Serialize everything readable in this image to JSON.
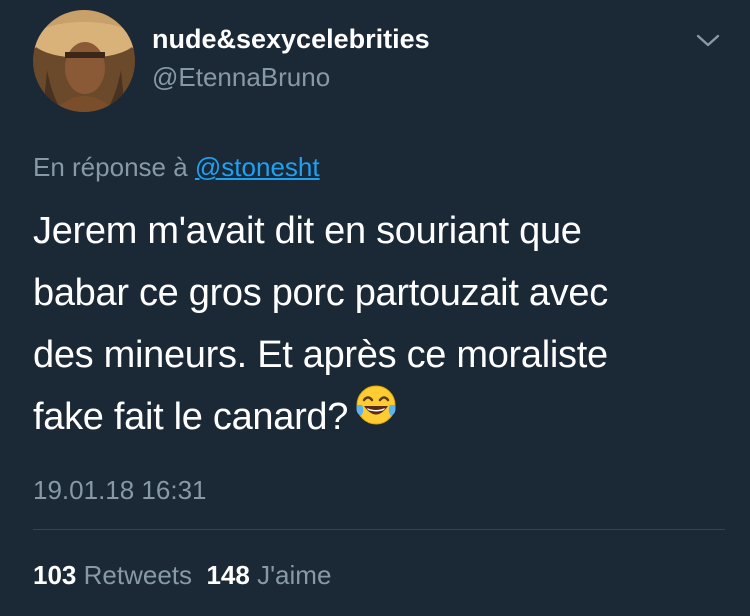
{
  "user": {
    "display_name": "nude&sexycelebrities",
    "handle": "@EtennaBruno"
  },
  "reply": {
    "prefix": "En réponse à",
    "mention": "@stonesht"
  },
  "tweet": {
    "lines": [
      "Jerem m'avait dit en souriant que",
      "babar ce gros porc partouzait avec",
      "des mineurs. Et après ce moraliste",
      "fake fait le canard?"
    ],
    "emoji": "face-with-tears-of-joy-icon",
    "timestamp": "19.01.18 16:31"
  },
  "stats": {
    "retweets_count": "103",
    "retweets_label": "Retweets",
    "likes_count": "148",
    "likes_label": "J'aime"
  },
  "colors": {
    "background": "#1b2836",
    "secondary_text": "#8899a6",
    "link": "#1da1f2",
    "divider": "#38444d"
  }
}
